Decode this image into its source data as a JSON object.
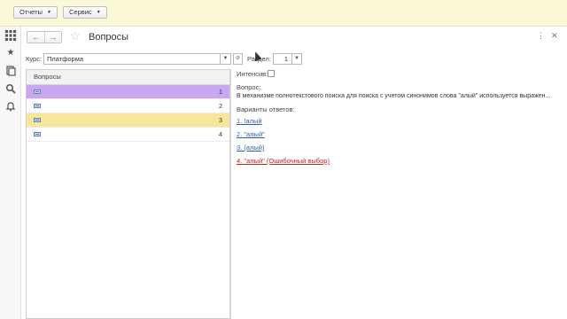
{
  "menu": {
    "reports": "Отчеты",
    "service": "Сервис"
  },
  "window": {
    "title": "Вопросы",
    "back_glyph": "←",
    "forward_glyph": "→",
    "star_glyph": "☆"
  },
  "filters": {
    "course_label": "Курс:",
    "course_value": "Платформа",
    "section_label": "Раздел:",
    "section_value": "1",
    "intensive_label": "Интенсив:"
  },
  "table": {
    "header": "Вопросы",
    "rows": [
      {
        "num": "1",
        "state": "selected"
      },
      {
        "num": "2",
        "state": "normal"
      },
      {
        "num": "3",
        "state": "current"
      },
      {
        "num": "4",
        "state": "normal"
      }
    ]
  },
  "detail": {
    "question_label": "Вопрос:",
    "question_text": "В механизме полнотекстового поиска для поиска с учетом синонимов слова \"алый\" используется выражен...",
    "answers_label": "Варианты ответов:",
    "answers": [
      "1. !алый",
      "2. \"алый\"",
      "3. (алый)",
      "4. \"алый\" (Ошибочный выбор)"
    ]
  },
  "colors": {
    "topbar": "#fbf8d8",
    "selected_row": "#c9a6f2",
    "current_row": "#f8e69a",
    "link": "#2f5fa8",
    "wrong_link": "#b22222"
  },
  "icons": [
    "grid-icon",
    "star-icon",
    "history-icon",
    "search-icon",
    "bell-icon"
  ]
}
